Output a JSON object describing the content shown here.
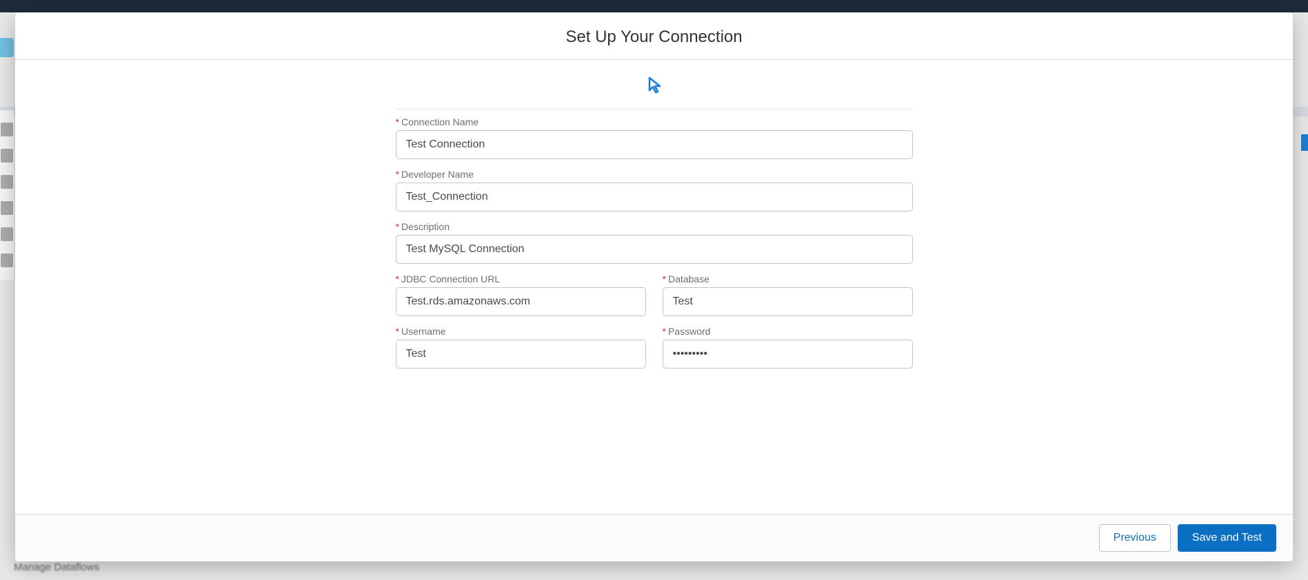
{
  "modal": {
    "title": "Set Up Your Connection",
    "iconName": "cursor-pointer-icon"
  },
  "form": {
    "connectionName": {
      "label": "Connection Name",
      "value": "Test Connection",
      "required": true
    },
    "developerName": {
      "label": "Developer Name",
      "value": "Test_Connection",
      "required": true
    },
    "description": {
      "label": "Description",
      "value": "Test MySQL Connection",
      "required": true
    },
    "jdbcUrl": {
      "label": "JDBC Connection URL",
      "value": "Test.rds.amazonaws.com",
      "required": true
    },
    "database": {
      "label": "Database",
      "value": "Test",
      "required": true
    },
    "username": {
      "label": "Username",
      "value": "Test",
      "required": true
    },
    "password": {
      "label": "Password",
      "value": "•••••••••",
      "required": true
    }
  },
  "footer": {
    "previous": "Previous",
    "saveAndTest": "Save and Test"
  },
  "background": {
    "bottomLeftText": "Manage Dataflows"
  },
  "colors": {
    "accent": "#0b6fc3",
    "required": "#c23934"
  }
}
